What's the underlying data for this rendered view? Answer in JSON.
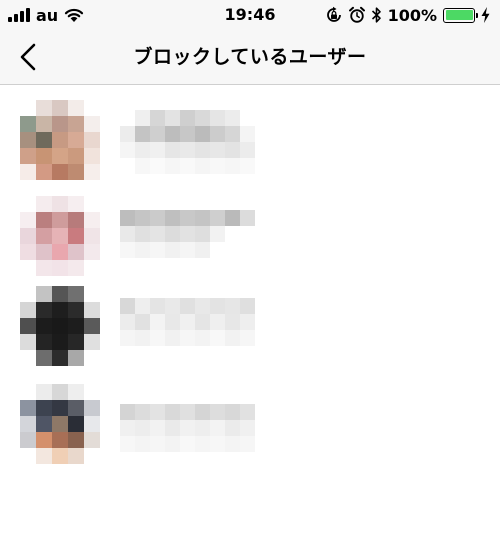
{
  "status_bar": {
    "carrier": "au",
    "time": "19:46",
    "battery_percent": "100%",
    "battery_level": 1.0,
    "icons": [
      "signal-icon",
      "wifi-icon",
      "rotation-lock-icon",
      "alarm-icon",
      "bluetooth-icon",
      "battery-icon",
      "charging-bolt-icon"
    ]
  },
  "nav": {
    "back_icon": "chevron-left-icon",
    "title": "ブロックしているユーザー"
  },
  "colors": {
    "bar_background": "#f7f7f7",
    "separator": "#cfcfcf",
    "battery_green": "#4cd964"
  },
  "users": [
    {
      "avatar_pixels": [
        [
          "#ffffff",
          "#e8ddd9",
          "#d9c8c2",
          "#f3ece9",
          "#ffffff"
        ],
        [
          "#8e9a8c",
          "#c9b5a6",
          "#b9968a",
          "#c8a493",
          "#f4eeec"
        ],
        [
          "#a7907f",
          "#6f6a5c",
          "#c79a83",
          "#d7aa95",
          "#e9d7cf"
        ],
        [
          "#cfa089",
          "#c89474",
          "#d4a487",
          "#cb9a7e",
          "#f1e3dc"
        ],
        [
          "#f6ece8",
          "#d39a84",
          "#b77a62",
          "#be8b71",
          "#f6eeeb"
        ]
      ],
      "name_pixels": [
        [
          "#ffffff",
          "#efefef",
          "#d6d6d6",
          "#e3e3e3",
          "#cfcfcf",
          "#d9d9d9",
          "#e5e5e5",
          "#ececec",
          "#ffffff"
        ],
        [
          "#ececec",
          "#c4c4c4",
          "#cfcfcf",
          "#bdbdbd",
          "#c7c7c7",
          "#bbbbbb",
          "#cccccc",
          "#d6d6d6",
          "#f4f4f4"
        ],
        [
          "#f5f5f5",
          "#ededed",
          "#f0f0f0",
          "#e6e6e6",
          "#e9e9e9",
          "#e4e4e4",
          "#e7e7e7",
          "#e3e3e3",
          "#ececec"
        ],
        [
          "#ffffff",
          "#f7f7f7",
          "#fafafa",
          "#f6f6f6",
          "#f9f9f9",
          "#f5f5f5",
          "#f8f8f8",
          "#f6f6f6",
          "#f9f9f9"
        ]
      ]
    },
    {
      "avatar_pixels": [
        [
          "#ffffff",
          "#f5ecee",
          "#efe2e5",
          "#f6eef0",
          "#ffffff"
        ],
        [
          "#f6eef0",
          "#ba7f7f",
          "#cf9c9c",
          "#b77b7b",
          "#f6eeef"
        ],
        [
          "#e9d6dc",
          "#d49fa2",
          "#e6b3b6",
          "#c97b7f",
          "#f0e4e7"
        ],
        [
          "#efdde2",
          "#dfc2c9",
          "#e9a7ae",
          "#dfc3ca",
          "#f3e9ec"
        ],
        [
          "#ffffff",
          "#f3e6ea",
          "#f2e3e8",
          "#f4e9ec",
          "#ffffff"
        ]
      ],
      "name_pixels": [
        [
          "#bdbdbd",
          "#c5c5c5",
          "#cbcbcb",
          "#bfbfbf",
          "#c8c8c8",
          "#c4c4c4",
          "#cfcfcf",
          "#bababa",
          "#dcdcdc"
        ],
        [
          "#e9e9e9",
          "#e0e0e0",
          "#e4e4e4",
          "#dcdcdc",
          "#e2e2e2",
          "#dedede",
          "#f2f2f2",
          "#ffffff",
          "#ffffff"
        ],
        [
          "#f7f7f7",
          "#f3f3f3",
          "#f6f6f6",
          "#f1f1f1",
          "#f5f5f5",
          "#f0f0f0",
          "#ffffff",
          "#ffffff",
          "#ffffff"
        ]
      ]
    },
    {
      "avatar_pixels": [
        [
          "#ffffff",
          "#c3c3c3",
          "#555555",
          "#707070",
          "#ffffff"
        ],
        [
          "#d5d5d5",
          "#2a2a2a",
          "#1e1e1e",
          "#2b2b2b",
          "#dcdcdc"
        ],
        [
          "#4f4f4f",
          "#1c1c1c",
          "#191919",
          "#1d1d1d",
          "#5a5a5a"
        ],
        [
          "#dcdcdc",
          "#242424",
          "#1b1b1b",
          "#272727",
          "#e0e0e0"
        ],
        [
          "#ffffff",
          "#6d6d6d",
          "#2c2c2c",
          "#a8a8a8",
          "#ffffff"
        ]
      ],
      "name_pixels": [
        [
          "#d8d8d8",
          "#eeeeee",
          "#e4e4e4",
          "#e9e9e9",
          "#e0e0e0",
          "#e8e8e8",
          "#e3e3e3",
          "#e6e6e6",
          "#dfdfdf"
        ],
        [
          "#ececec",
          "#e1e1e1",
          "#f3f3f3",
          "#e8e8e8",
          "#f0f0f0",
          "#e5e5e5",
          "#efefef",
          "#e7e7e7",
          "#eeeeee"
        ],
        [
          "#f5f5f5",
          "#f2f2f2",
          "#f7f7f7",
          "#f1f1f1",
          "#f6f6f6",
          "#f3f3f3",
          "#f8f8f8",
          "#f2f2f2",
          "#f6f6f6"
        ]
      ]
    },
    {
      "avatar_pixels": [
        [
          "#ffffff",
          "#ececec",
          "#d7d7d7",
          "#eeeeee",
          "#ffffff"
        ],
        [
          "#8c93a0",
          "#3d4350",
          "#343843",
          "#5a5d66",
          "#c8cad0"
        ],
        [
          "#d3d5da",
          "#4f5565",
          "#8e7867",
          "#2a2d36",
          "#e7e8eb"
        ],
        [
          "#cbcbcf",
          "#d4906c",
          "#a86f56",
          "#89624f",
          "#e3dcd7"
        ],
        [
          "#ffffff",
          "#f3e7df",
          "#f0cfb5",
          "#e9d8cc",
          "#ffffff"
        ]
      ],
      "name_pixels": [
        [
          "#d4d4d4",
          "#dcdcdc",
          "#e3e3e3",
          "#d9d9d9",
          "#e0e0e0",
          "#d5d5d5",
          "#dddddd",
          "#d8d8d8",
          "#e1e1e1"
        ],
        [
          "#f0f0f0",
          "#ededed",
          "#f2f2f2",
          "#eaeaea",
          "#f1f1f1",
          "#eeeeee",
          "#f3f3f3",
          "#ebebeb",
          "#f0f0f0"
        ],
        [
          "#f7f7f7",
          "#f4f4f4",
          "#f6f6f6",
          "#f3f3f3",
          "#f8f8f8",
          "#f5f5f5",
          "#f7f7f7",
          "#f4f4f4",
          "#f6f6f6"
        ]
      ]
    }
  ]
}
